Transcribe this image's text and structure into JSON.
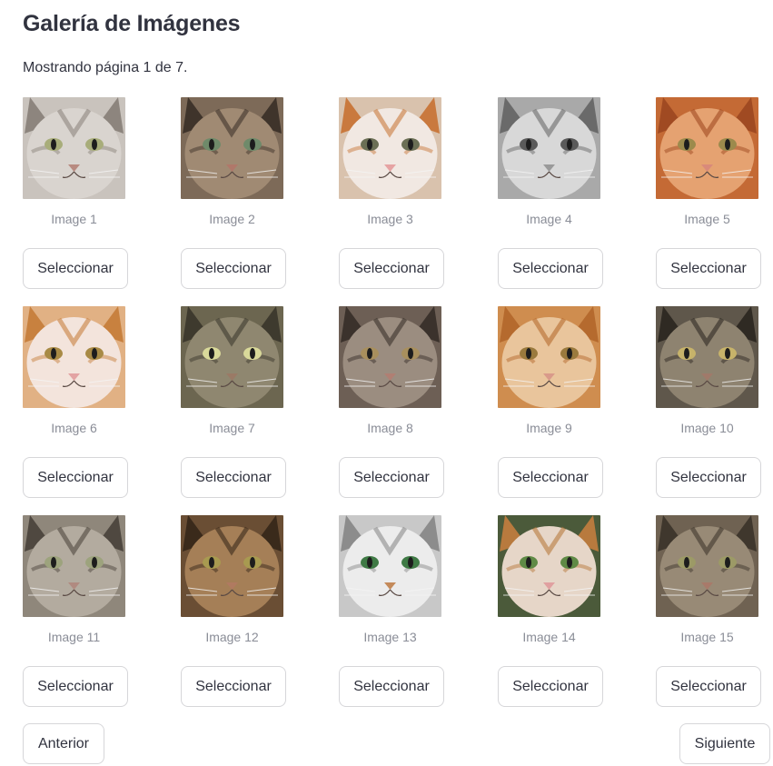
{
  "page": {
    "title": "Galería de Imágenes",
    "status": "Mostrando página 1 de 7."
  },
  "gallery": {
    "rows": [
      [
        {
          "caption": "Image 1",
          "button": "Seleccionar",
          "palette": {
            "bg": "#c9c3bd",
            "fur": "#d9d4cf",
            "dark": "#8d857e",
            "eye": "#a8ad7a",
            "nose": "#b88a80"
          }
        },
        {
          "caption": "Image 2",
          "button": "Seleccionar",
          "palette": {
            "bg": "#7d6a58",
            "fur": "#a08a73",
            "dark": "#3f342b",
            "eye": "#6f8a6a",
            "nose": "#b0786a"
          }
        },
        {
          "caption": "Image 3",
          "button": "Seleccionar",
          "palette": {
            "bg": "#d9c2ad",
            "fur": "#f1e8e2",
            "dark": "#c9793e",
            "eye": "#6b6f55",
            "nose": "#e6a3a3"
          }
        },
        {
          "caption": "Image 4",
          "button": "Seleccionar",
          "palette": {
            "bg": "#a9a9a9",
            "fur": "#d8d8d8",
            "dark": "#6a6a6a",
            "eye": "#5a5a5a",
            "nose": "#9a9a9a"
          }
        },
        {
          "caption": "Image 5",
          "button": "Seleccionar",
          "palette": {
            "bg": "#c46a35",
            "fur": "#e5a271",
            "dark": "#a04a22",
            "eye": "#9c8a4c",
            "nose": "#d98a7a"
          }
        }
      ],
      [
        {
          "caption": "Image 6",
          "button": "Seleccionar",
          "palette": {
            "bg": "#e1b184",
            "fur": "#f3e4dc",
            "dark": "#c8813f",
            "eye": "#a88a45",
            "nose": "#e3a3a3"
          }
        },
        {
          "caption": "Image 7",
          "button": "Seleccionar",
          "palette": {
            "bg": "#6c6650",
            "fur": "#8f8770",
            "dark": "#3e3a2e",
            "eye": "#d9d99a",
            "nose": "#9a7a66"
          }
        },
        {
          "caption": "Image 8",
          "button": "Seleccionar",
          "palette": {
            "bg": "#6d5f55",
            "fur": "#9b8d80",
            "dark": "#3b322c",
            "eye": "#a88f5d",
            "nose": "#b07f73"
          }
        },
        {
          "caption": "Image 9",
          "button": "Seleccionar",
          "palette": {
            "bg": "#cf8d4f",
            "fur": "#e9c59c",
            "dark": "#b56a2e",
            "eye": "#9a7a3d",
            "nose": "#d99a8a"
          }
        },
        {
          "caption": "Image 10",
          "button": "Seleccionar",
          "palette": {
            "bg": "#5f574b",
            "fur": "#8e8370",
            "dark": "#2f2a23",
            "eye": "#c7b36a",
            "nose": "#a07a6a"
          }
        }
      ],
      [
        {
          "caption": "Image 11",
          "button": "Seleccionar",
          "palette": {
            "bg": "#8f877b",
            "fur": "#b3ab9f",
            "dark": "#4f4840",
            "eye": "#9da37d",
            "nose": "#b08a80"
          }
        },
        {
          "caption": "Image 12",
          "button": "Seleccionar",
          "palette": {
            "bg": "#6a4e34",
            "fur": "#a57f57",
            "dark": "#3a2a1b",
            "eye": "#a89a50",
            "nose": "#b07a60"
          }
        },
        {
          "caption": "Image 13",
          "button": "Seleccionar",
          "palette": {
            "bg": "#c8c8c8",
            "fur": "#ececec",
            "dark": "#8c8c8c",
            "eye": "#3f7a45",
            "nose": "#c48a5a"
          }
        },
        {
          "caption": "Image 14",
          "button": "Seleccionar",
          "palette": {
            "bg": "#4b5a3a",
            "fur": "#e6d6c8",
            "dark": "#b87a3e",
            "eye": "#5f8a45",
            "nose": "#e0a0a0"
          }
        },
        {
          "caption": "Image 15",
          "button": "Seleccionar",
          "palette": {
            "bg": "#6f6252",
            "fur": "#988a76",
            "dark": "#3f372d",
            "eye": "#9c9a66",
            "nose": "#a87a6a"
          }
        }
      ]
    ]
  },
  "pagination": {
    "prev": "Anterior",
    "next": "Siguiente"
  }
}
